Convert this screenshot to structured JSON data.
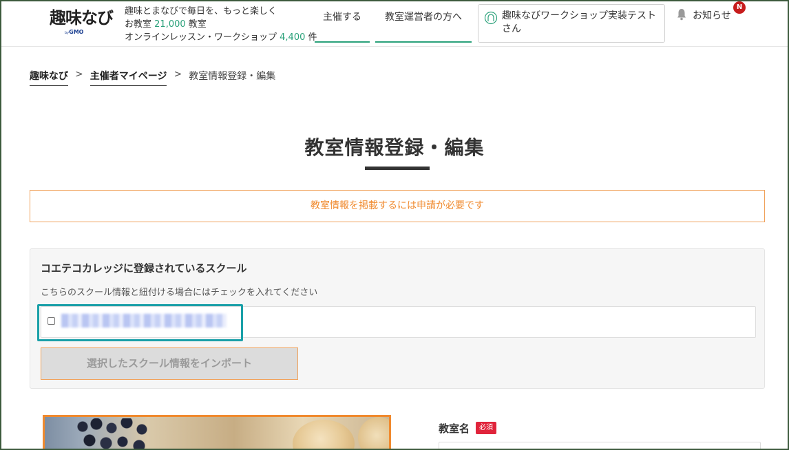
{
  "header": {
    "logo_main": "趣味なび",
    "logo_by": "by",
    "logo_brand": "GMO",
    "tagline_line1": "趣味とまなびで毎日を、もっと楽しく",
    "classroom_prefix": "お教室",
    "classroom_count": "21,000",
    "classroom_suffix": "教室",
    "online_prefix": "オンラインレッスン・ワークショップ",
    "online_count": "4,400",
    "online_suffix": "件",
    "nav_host": "主催する",
    "nav_operators": "教室運営者の方へ",
    "user_name": "趣味なびワークショップ実装テストさん",
    "notice_label": "お知らせ",
    "notice_badge": "N"
  },
  "breadcrumb": {
    "home": "趣味なび",
    "mypage": "主催者マイページ",
    "current": "教室情報登録・編集",
    "separator": ">"
  },
  "page": {
    "title": "教室情報登録・編集",
    "alert": "教室情報を掲載するには申請が必要です"
  },
  "school_panel": {
    "title": "コエテコカレッジに登録されているスクール",
    "description": "こちらのスクール情報と紐付ける場合にはチェックを入れてください",
    "import_button": "選択したスクール情報をインポート"
  },
  "form": {
    "classroom_name_label": "教室名",
    "required_badge": "必須"
  },
  "colors": {
    "accent_green": "#2aa17a",
    "alert_orange": "#f08a2e",
    "highlight_teal": "#1aa0a8",
    "required_red": "#e0243b"
  }
}
